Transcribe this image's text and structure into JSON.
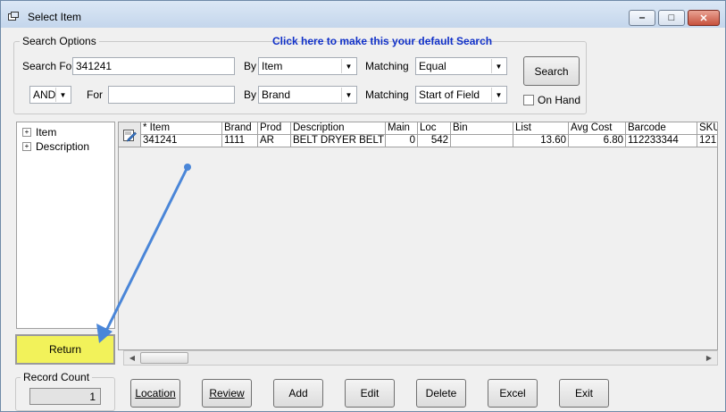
{
  "window": {
    "title": "Select Item",
    "minimize_glyph": "‒",
    "maximize_glyph": "□",
    "close_glyph": "✕"
  },
  "search_options": {
    "legend": "Search Options",
    "default_link": "Click here to make this your default Search",
    "row1": {
      "label": "Search For",
      "value": "341241",
      "by_label": "By",
      "by_value": "Item",
      "matching_label": "Matching",
      "matching_value": "Equal"
    },
    "row2": {
      "conjunction": "AND",
      "for_label": "For",
      "value": "",
      "by_label": "By",
      "by_value": "Brand",
      "matching_label": "Matching",
      "matching_value": "Start of Field"
    },
    "search_button": "Search",
    "on_hand_label": "On Hand",
    "on_hand_checked": false
  },
  "tree": {
    "items": [
      {
        "label": "Item"
      },
      {
        "label": "Description"
      }
    ]
  },
  "grid": {
    "columns": [
      "* Item",
      "Brand",
      "Prod",
      "Description",
      "Main",
      "Loc",
      "Bin",
      "List",
      "Avg Cost",
      "Barcode",
      "SKU"
    ],
    "rows": [
      [
        "341241",
        "1111",
        "AR",
        "BELT DRYER BELT FOR",
        "0",
        "542",
        "",
        "13.60",
        "6.80",
        "112233344",
        "121"
      ]
    ]
  },
  "return_button": "Return",
  "record_count": {
    "legend": "Record Count",
    "value": "1"
  },
  "buttons": {
    "location": "Location",
    "review": "Review",
    "add": "Add",
    "edit": "Edit",
    "delete": "Delete",
    "excel": "Excel",
    "exit": "Exit"
  },
  "colors": {
    "return_highlight": "#f2f25a",
    "link": "#1030c8",
    "annotation_arrow": "#4a86d8"
  }
}
